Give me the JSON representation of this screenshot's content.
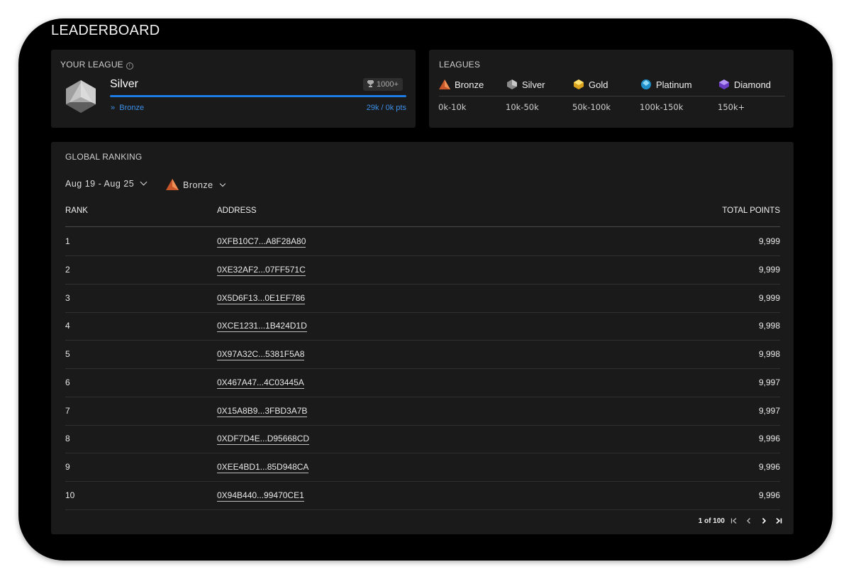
{
  "header": {
    "title": "LEADERBOARD"
  },
  "your_league": {
    "label": "YOUR LEAGUE",
    "info_icon": "info-icon",
    "league_name": "Silver",
    "trophy_icon": "trophy-icon",
    "trophy_value": "1000+",
    "progress": 1.0,
    "next_league_prefix": "»",
    "next_league": "Bronze",
    "points": "29k / 0k pts"
  },
  "leagues": {
    "label": "LEAGUES",
    "items": [
      {
        "name": "Bronze",
        "range": "0k-10k",
        "icon": "bronze-gem-icon",
        "color": "#e0733a"
      },
      {
        "name": "Silver",
        "range": "10k-50k",
        "icon": "silver-gem-icon",
        "color": "#9a9a9a"
      },
      {
        "name": "Gold",
        "range": "50k-100k",
        "icon": "gold-gem-icon",
        "color": "#f2c230"
      },
      {
        "name": "Platinum",
        "range": "100k-150k",
        "icon": "platinum-gem-icon",
        "color": "#3fb3e6"
      },
      {
        "name": "Diamond",
        "range": "150k+",
        "icon": "diamond-gem-icon",
        "color": "#8f5ee8"
      }
    ]
  },
  "ranking": {
    "label": "GLOBAL RANKING",
    "date_filter": "Aug 19 - Aug 25",
    "league_filter": "Bronze",
    "columns": {
      "rank": "RANK",
      "address": "ADDRESS",
      "points": "TOTAL POINTS"
    },
    "rows": [
      {
        "rank": "1",
        "address": "0XFB10C7...A8F28A80",
        "points": "9,999"
      },
      {
        "rank": "2",
        "address": "0XE32AF2...07FF571C",
        "points": "9,999"
      },
      {
        "rank": "3",
        "address": "0X5D6F13...0E1EF786",
        "points": "9,999"
      },
      {
        "rank": "4",
        "address": "0XCE1231...1B424D1D",
        "points": "9,998"
      },
      {
        "rank": "5",
        "address": "0X97A32C...5381F5A8",
        "points": "9,998"
      },
      {
        "rank": "6",
        "address": "0X467A47...4C03445A",
        "points": "9,997"
      },
      {
        "rank": "7",
        "address": "0X15A8B9...3FBD3A7B",
        "points": "9,997"
      },
      {
        "rank": "8",
        "address": "0XDF7D4E...D95668CD",
        "points": "9,996"
      },
      {
        "rank": "9",
        "address": "0XEE4BD1...85D948CA",
        "points": "9,996"
      },
      {
        "rank": "10",
        "address": "0X94B440...99470CE1",
        "points": "9,996"
      }
    ],
    "pagination": {
      "info": "1 of 100",
      "first": "|<",
      "prev": "<",
      "next": ">",
      "last": ">|"
    }
  }
}
